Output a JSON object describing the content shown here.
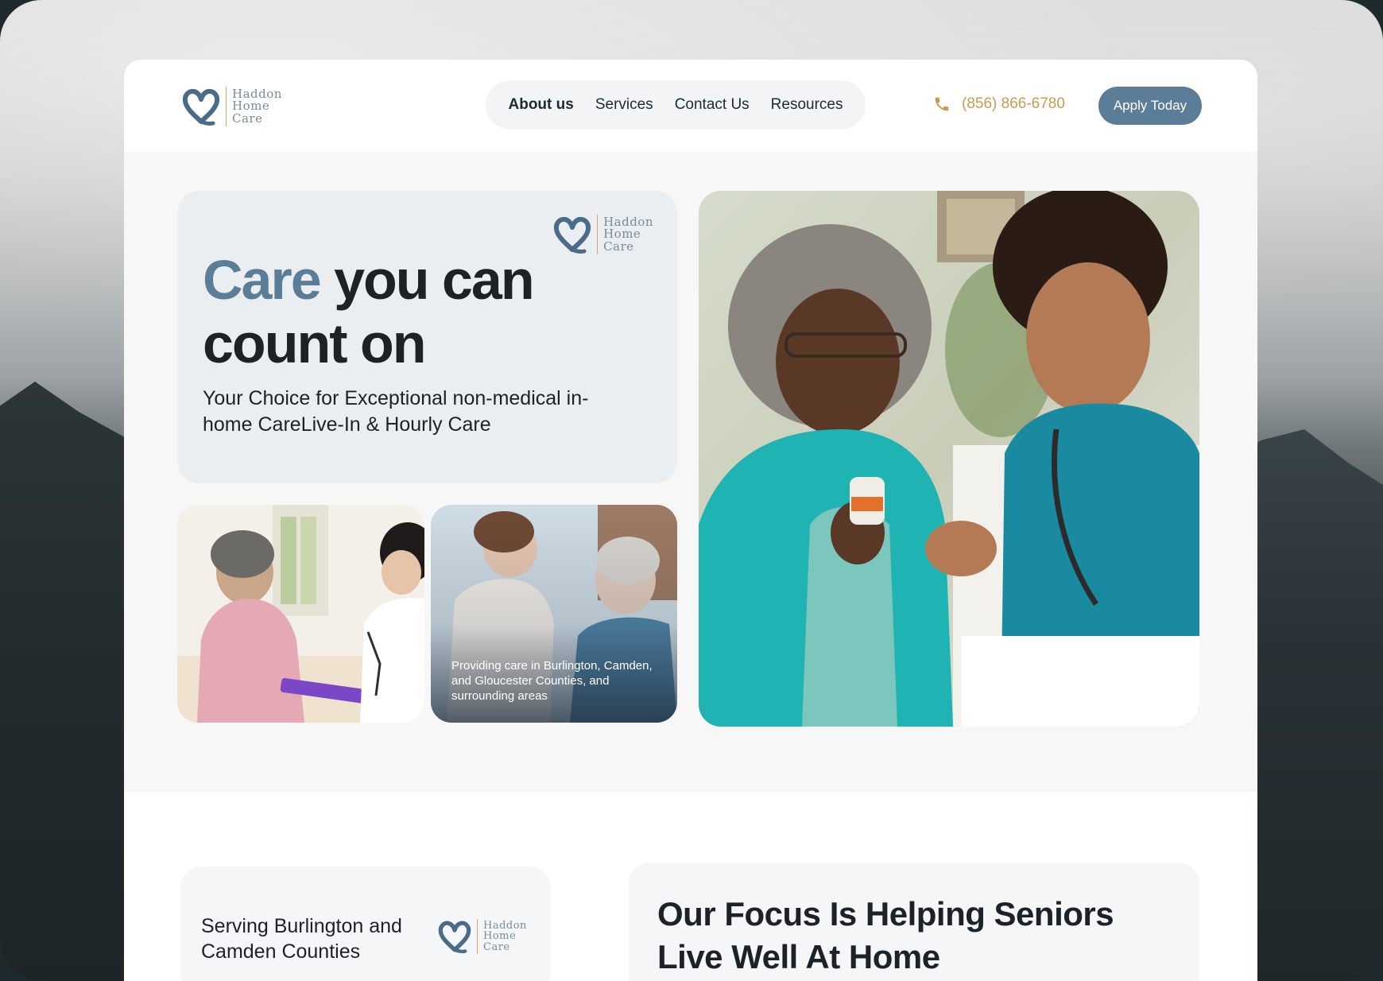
{
  "brand": {
    "logo_words": [
      "Haddon",
      "Home",
      "Care"
    ],
    "colors": {
      "accent": "#5b7d97",
      "gold": "#c99a4f",
      "text": "#1d2226"
    }
  },
  "nav": {
    "items": [
      {
        "label": "About us",
        "active": true
      },
      {
        "label": "Services",
        "active": false
      },
      {
        "label": "Contact Us",
        "active": false
      },
      {
        "label": "Resources",
        "active": false
      }
    ]
  },
  "contact": {
    "phone": "(856) 866-6780",
    "icon": "phone-icon"
  },
  "cta": {
    "apply_label": "Apply Today"
  },
  "hero": {
    "title_accent": "Care",
    "title_rest": " you can count on",
    "subtitle": "Your Choice for Exceptional non-medical in-home CareLive-In & Hourly Care"
  },
  "photos": {
    "caption": "Providing care in Burlington, Camden, and Gloucester Counties, and surrounding areas"
  },
  "sections": {
    "serving": "Serving Burlington and Camden Counties",
    "focus_title": "Our Focus Is Helping Seniors Live Well At Home"
  }
}
